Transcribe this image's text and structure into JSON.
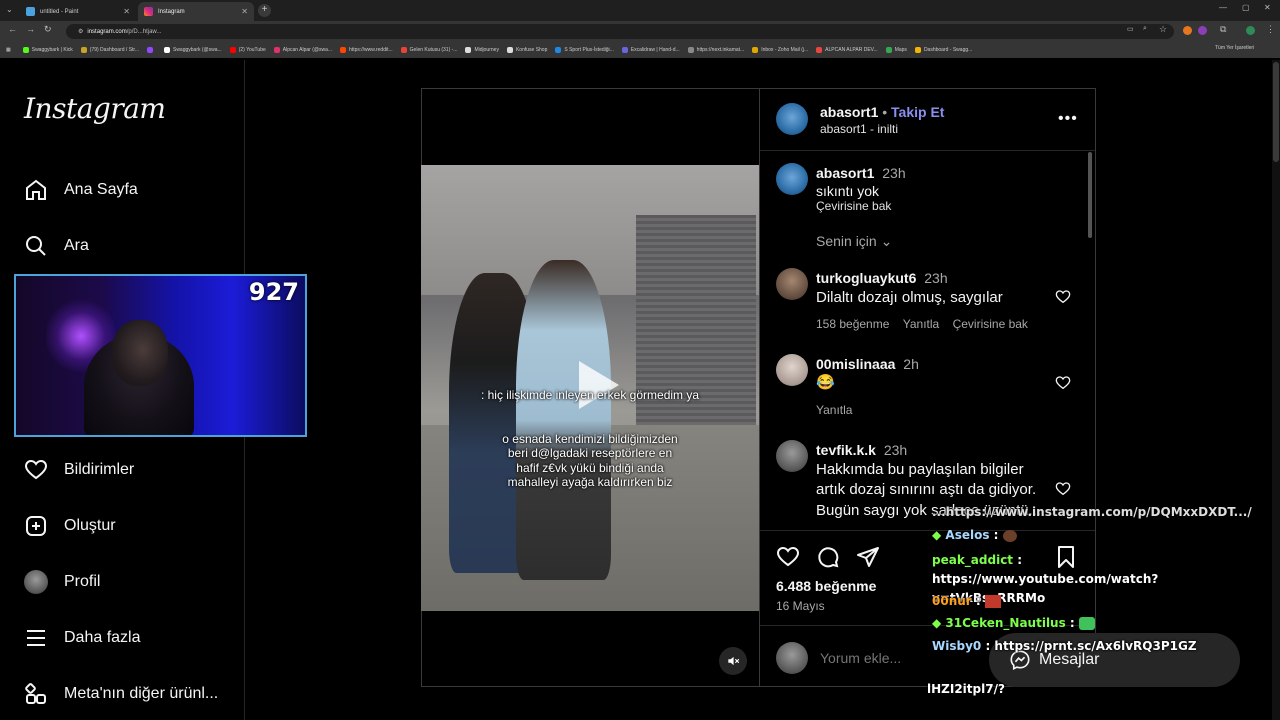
{
  "browser": {
    "tabs": [
      {
        "title": "untitled - Paint",
        "close": "✕"
      },
      {
        "title": "Instagram",
        "close": "✕"
      }
    ],
    "new_tab": "+",
    "window_controls": [
      "—",
      "▢",
      "✕"
    ],
    "url_host": "instagram.com",
    "url_path": "/p/D...htjaw...",
    "bookmarks": [
      {
        "label": "Swaggybark | Kick",
        "color": "#53fc18"
      },
      {
        "label": "(79) Dashboard / Str...",
        "color": "#c9a227"
      },
      {
        "label": "",
        "color": "#9146ff"
      },
      {
        "label": "Swaggybark (@swa...",
        "color": "#ffffff"
      },
      {
        "label": "(2) YouTube",
        "color": "#ff0000"
      },
      {
        "label": "Alpcan Alpar (@swa...",
        "color": "#e1306c"
      },
      {
        "label": "https://www.reddit...",
        "color": "#ff4500"
      },
      {
        "label": "Gelen Kutusu (31) -...",
        "color": "#ea4335"
      },
      {
        "label": "Midjourney",
        "color": "#dddddd"
      },
      {
        "label": "Konfuse Shop",
        "color": "#dddddd"
      },
      {
        "label": "S Sport Plus-İstediği...",
        "color": "#1e88e5"
      },
      {
        "label": "Excalidraw | Hand-d...",
        "color": "#6965db"
      },
      {
        "label": "https://next.inkamat...",
        "color": "#888888"
      },
      {
        "label": "Inbox - Zoho Mail (j...",
        "color": "#e0a800"
      },
      {
        "label": "ALPCAN ALPAR DEV...",
        "color": "#e8453c"
      },
      {
        "label": "Maps",
        "color": "#34a853"
      },
      {
        "label": "Dashboard - Swagg...",
        "color": "#f4b400"
      }
    ],
    "all_bookmarks": "Tüm Yer İşaretleri"
  },
  "sidebar": {
    "logo": "Instagram",
    "items": [
      {
        "label": "Ana Sayfa",
        "icon": "home-icon"
      },
      {
        "label": "Ara",
        "icon": "search-icon"
      },
      {
        "label": "Bildirimler",
        "icon": "heart-icon"
      },
      {
        "label": "Oluştur",
        "icon": "plus-square-icon"
      },
      {
        "label": "Profil",
        "icon": "profile-avatar"
      },
      {
        "label": "Daha fazla",
        "icon": "menu-icon"
      },
      {
        "label": "Meta'nın diğer ürünl...",
        "icon": "meta-apps-icon"
      }
    ]
  },
  "webcam": {
    "counter": "927"
  },
  "video": {
    "caption_top": ": hiç ilişkimde inleyen erkek görmedim ya",
    "caption_bottom": "o esnada kendimizi bildiğimizden beri d@lgadaki reseptörlere en hafif z€vk yükü bindiği anda mahalleyi ayağa kaldırırken biz"
  },
  "post": {
    "author": "abasort1",
    "separator": "•",
    "follow_label": "Takip Et",
    "audio": "abasort1 - inilti",
    "caption_author": "abasort1",
    "caption_time": "23h",
    "caption_text": "sıkıntı yok",
    "see_translation": "Çevirisine bak",
    "for_you": "Senin için",
    "comments": [
      {
        "user": "turkogluaykut6",
        "time": "23h",
        "text": "Dilaltı dozajı olmuş, saygılar",
        "likes": "158 beğenme",
        "reply": "Yanıtla",
        "translate": "Çevirisine bak"
      },
      {
        "user": "00mislinaaa",
        "time": "2h",
        "text": "😂",
        "reply": "Yanıtla"
      },
      {
        "user": "tevfik.k.k",
        "time": "23h",
        "text": "Hakkımda bu paylaşılan bilgiler artık dozaj sınırını aştı da gidiyor. Bugün saygı yok sadece üzüntü..."
      }
    ],
    "likes": "6.488 beğenme",
    "date": "16 Mayıs",
    "comment_placeholder": "Yorum ekle..."
  },
  "chat": {
    "messages": [
      {
        "user": "Aselos",
        "color": "#a8d8ff",
        "text": ""
      },
      {
        "user": "peak_addict",
        "color": "#7cff4a",
        "text": "https://www.youtube.com/watch?v=tVkBseRRRMo"
      },
      {
        "user": "00nur",
        "color": "#ff9f1a",
        "text": ""
      },
      {
        "user": "31Ceken_Nautilus",
        "color": "#7cff4a",
        "text": ""
      },
      {
        "user": "Wisby0",
        "color": "#a8d8ff",
        "text": "https://prnt.sc/Ax6lvRQ3P1GZ"
      }
    ],
    "top_cut": "...https://www.instagram.com/p/DQMxxDXDT.../",
    "bottom_cut": "lHZI2itpl7/?",
    "sep": " : "
  },
  "messages_button": "Mesajlar"
}
